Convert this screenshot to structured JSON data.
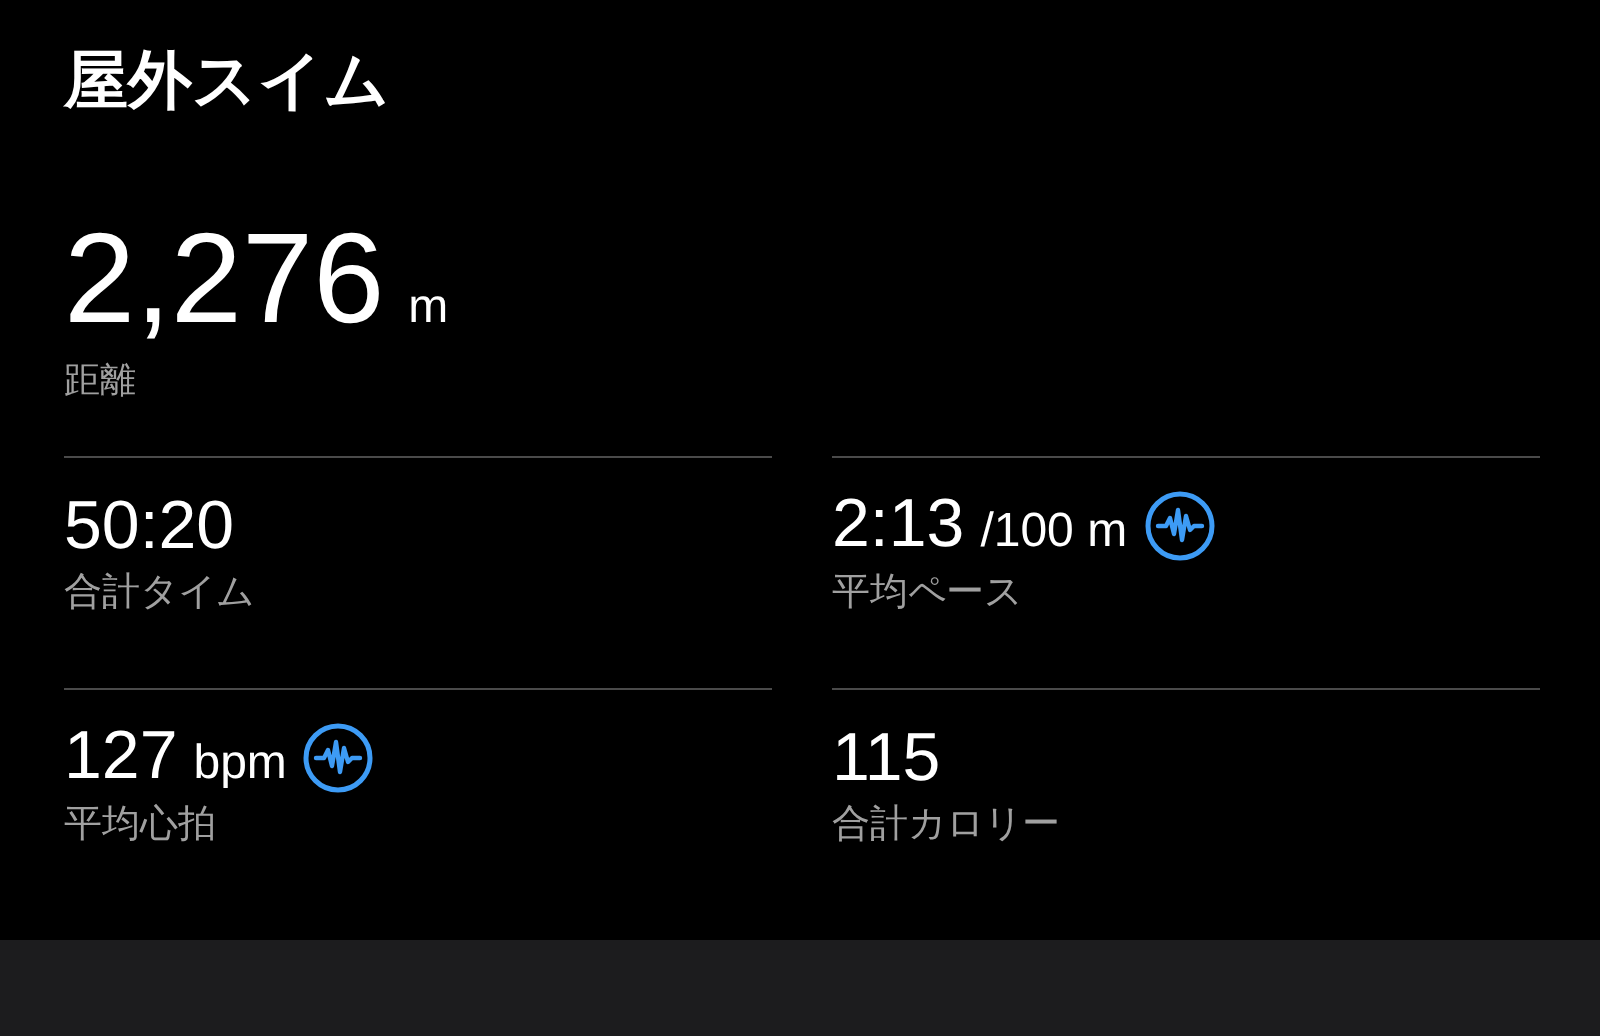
{
  "title": "屋外スイム",
  "distance": {
    "value": "2,276",
    "unit": "m",
    "label": "距離"
  },
  "metrics": [
    {
      "value": "50:20",
      "label": "合計タイム",
      "kind": "plain"
    },
    {
      "value": "2:13",
      "unit": "/100 m",
      "label": "平均ペース",
      "kind": "chart-link"
    },
    {
      "value": "127",
      "unit": "bpm",
      "label": "平均心拍",
      "kind": "chart-link"
    },
    {
      "value": "115",
      "label": "合計カロリー",
      "kind": "plain"
    }
  ]
}
